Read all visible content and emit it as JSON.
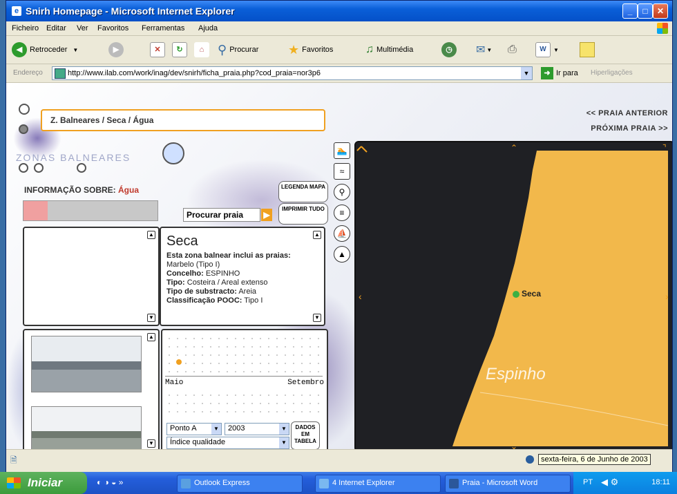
{
  "window": {
    "title": "Snirh Homepage - Microsoft Internet Explorer",
    "minimize": "_",
    "maximize": "□",
    "close": "✕"
  },
  "menu": [
    "Ficheiro",
    "Editar",
    "Ver",
    "Favoritos",
    "Ferramentas",
    "Ajuda"
  ],
  "toolbar": {
    "back_label": "Retroceder",
    "search_label": "Procurar",
    "favorites_label": "Favoritos",
    "media_label": "Multimédia"
  },
  "address": {
    "label": "Endereço",
    "url": "http://www.ilab.com/work/inag/dev/snirh/ficha_praia.php?cod_praia=nor3p6",
    "go_label": "Ir para",
    "links_label": "Hiperligações"
  },
  "page": {
    "breadcrumb": "Z. Balneares / Seca / Água",
    "prev_beach": "<< PRAIA ANTERIOR",
    "next_beach": "PRÓXIMA PRAIA >>",
    "section_logo": "ZONAS BALNEARES",
    "info_label": "INFORMAÇÃO SOBRE:",
    "info_value": "Água",
    "legend_button": "LEGENDA MAPA",
    "print_button": "IMPRIMIR TUDO",
    "search_beach_button": "Procurar praia",
    "beach": {
      "name": "Seca",
      "intro_bold": "Esta zona balnear inclui as praias:",
      "intro_value": "Marbelo (Tipo I)",
      "concelho_label": "Concelho:",
      "concelho_value": "ESPINHO",
      "tipo_label": "Tipo:",
      "tipo_value": "Costeira / Areal extenso",
      "substrato_label": "Tipo de substracto:",
      "substrato_value": "Areia",
      "classificacao_label": "Classificação POOC:",
      "classificacao_value": "Tipo I"
    },
    "chart": {
      "x_start": "Maio",
      "x_end": "Setembro",
      "point_color": "#f0a020"
    },
    "controls": {
      "point_select": "Ponto A",
      "year_select": "2003",
      "indicator_select": "Índice qualidade",
      "table_button": "DADOS EM TABELA"
    },
    "map": {
      "point_label": "Seca",
      "place_label": "Espinho",
      "land_color": "#f2b84b",
      "sea_color": "#1f2024",
      "point_color": "#3cb043"
    }
  },
  "status": {
    "date": "sexta-feira, 6 de Junho de 2003"
  },
  "taskbar": {
    "start": "Iniciar",
    "tasks": [
      "Outlook Express",
      "4 Internet Explorer",
      "Praia - Microsoft Word"
    ],
    "lang": "PT",
    "clock": "18:11"
  }
}
